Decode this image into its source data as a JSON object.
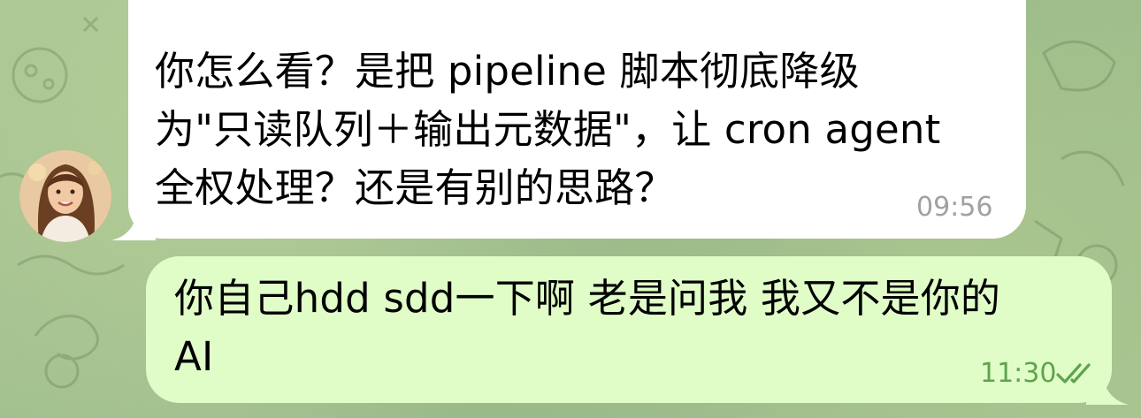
{
  "chat": {
    "messages": [
      {
        "sender": "incoming",
        "lines": [
          "你怎么看？是把 pipeline 脚本彻底降级",
          "为\"只读队列＋输出元数据\"，让 cron agent",
          "全权处理？还是有别的思路？"
        ],
        "time": "09:56"
      },
      {
        "sender": "outgoing",
        "lines": [
          "你自己hdd sdd一下啊 老是问我 我又不是你的",
          "AI"
        ],
        "time": "11:30",
        "status_icon": "double-check-icon"
      }
    ]
  },
  "colors": {
    "incoming_bubble": "#ffffff",
    "outgoing_bubble": "#e0fdc8",
    "outgoing_time": "#5fa34e",
    "incoming_time": "#a1a1a1",
    "wallpaper": "#9dbb8c"
  }
}
